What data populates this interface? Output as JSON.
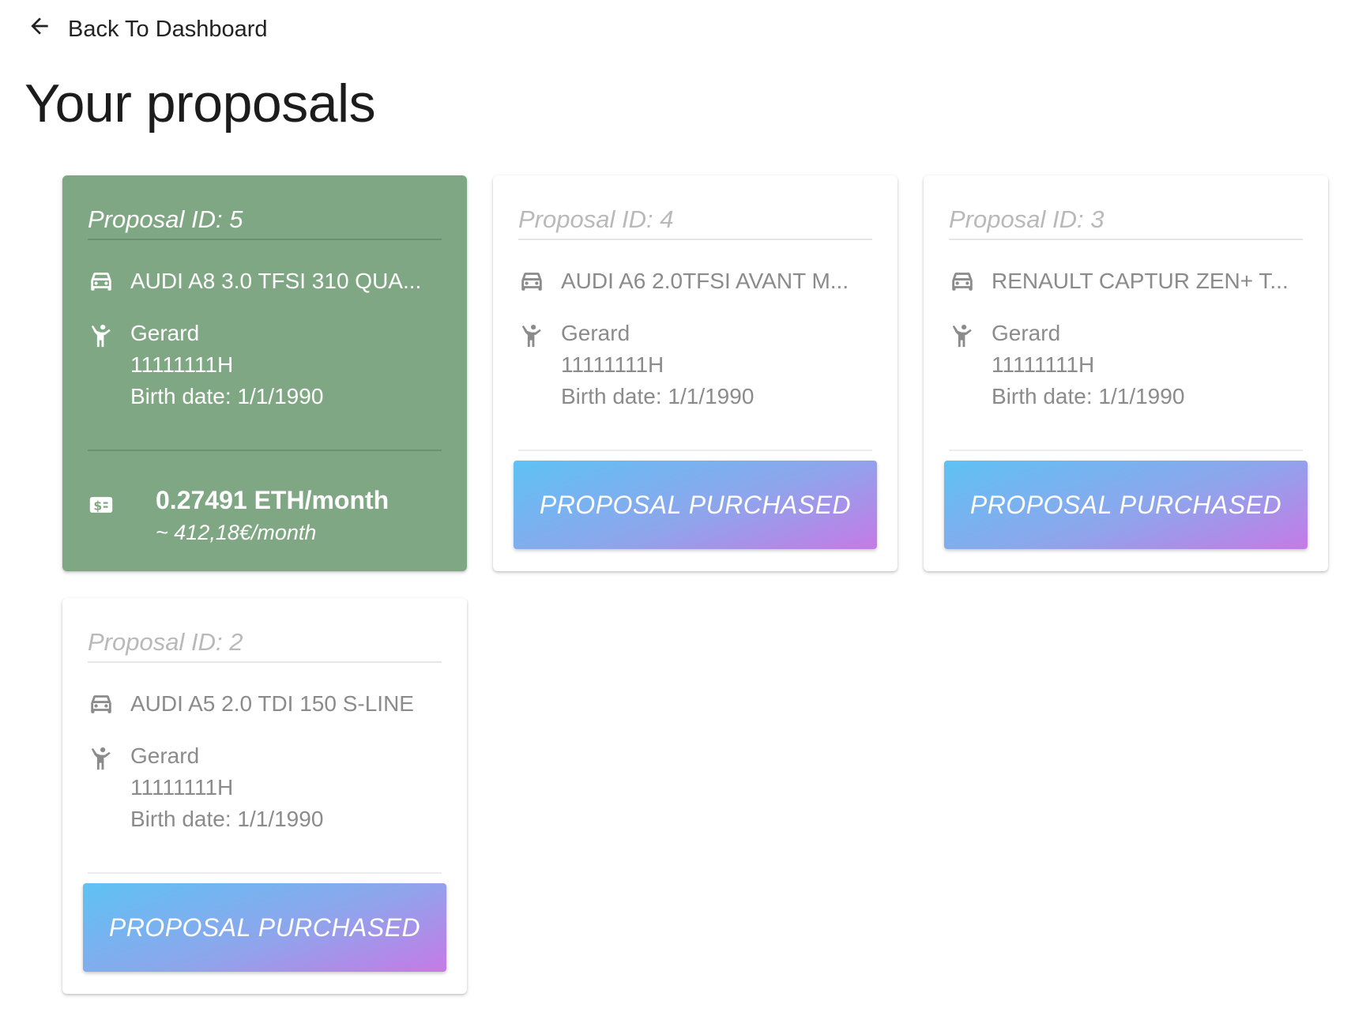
{
  "nav": {
    "back_label": "Back To Dashboard"
  },
  "page": {
    "title": "Your proposals"
  },
  "proposals": [
    {
      "title": "Proposal ID: 5",
      "car": "AUDI A8 3.0 TFSI 310 QUA...",
      "person_name": "Gerard",
      "person_id": "11111111H",
      "birth_date": "Birth date: 1/1/1990",
      "price_eth": "0.27491 ETH/month",
      "price_eur": "~ 412,18€/month",
      "selected": true
    },
    {
      "title": "Proposal ID: 4",
      "car": "AUDI A6 2.0TFSI AVANT M...",
      "person_name": "Gerard",
      "person_id": "11111111H",
      "birth_date": "Birth date: 1/1/1990",
      "button_label": "PROPOSAL PURCHASED"
    },
    {
      "title": "Proposal ID: 3",
      "car": "RENAULT CAPTUR ZEN+ T...",
      "person_name": "Gerard",
      "person_id": "11111111H",
      "birth_date": "Birth date: 1/1/1990",
      "button_label": "PROPOSAL PURCHASED"
    },
    {
      "title": "Proposal ID: 2",
      "car": "AUDI A5 2.0 TDI 150 S-LINE",
      "person_name": "Gerard",
      "person_id": "11111111H",
      "birth_date": "Birth date: 1/1/1990",
      "button_label": "PROPOSAL PURCHASED"
    }
  ],
  "icons": {
    "back": "arrow-left-icon",
    "car": "car-icon",
    "person": "person-icon",
    "price": "money-icon"
  },
  "colors": {
    "selected_card": "#80a784",
    "button_gradient_start": "#5ec2f4",
    "button_gradient_end": "#c57ae6",
    "muted_text": "#8b8b8b"
  }
}
